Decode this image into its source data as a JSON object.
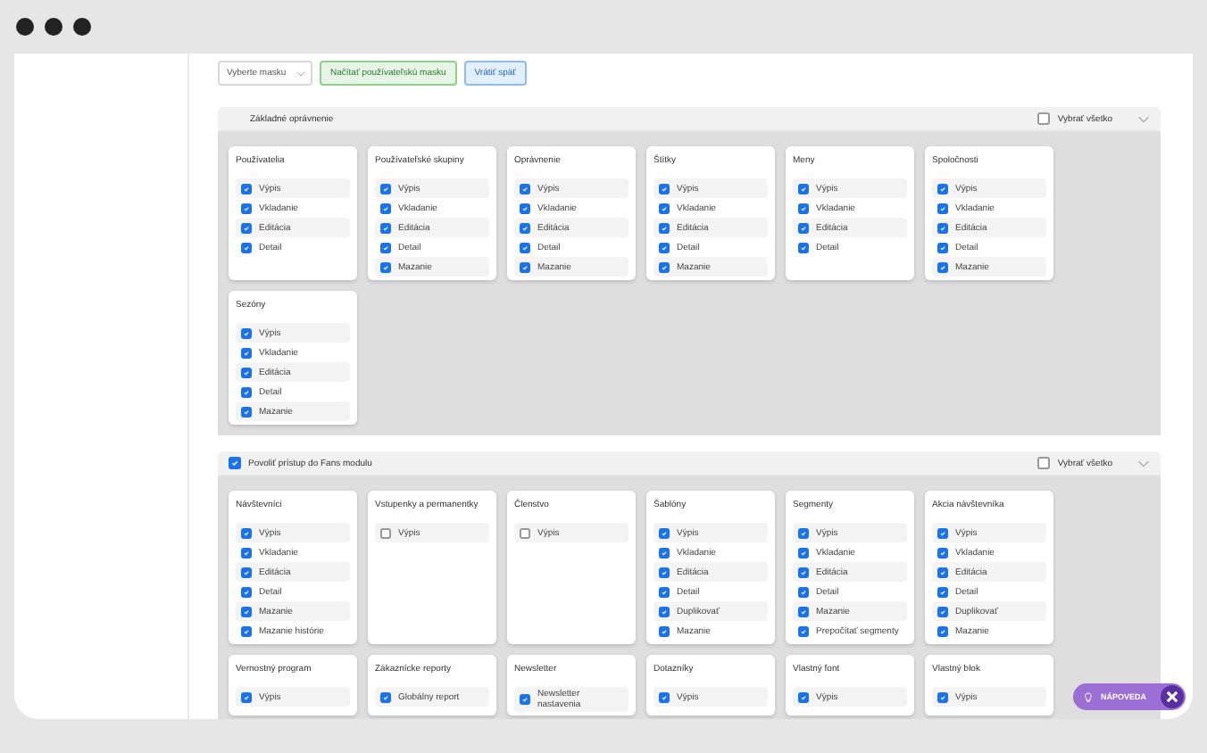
{
  "toolbar": {
    "mask_select": {
      "value": "Vyberte masku"
    },
    "buttons": [
      {
        "label": "Načítať používateľskú masku",
        "kind": "success"
      },
      {
        "label": "Vrátiť späť",
        "kind": "info"
      }
    ]
  },
  "sections": [
    {
      "kind": "heading",
      "title": "Základné oprávnenie",
      "select_all": {
        "label": "Vybrať všetko",
        "checked": false
      },
      "cards": [
        {
          "title": "Používatelia",
          "items": [
            {
              "label": "Výpis",
              "checked": true
            },
            {
              "label": "Vkladanie",
              "checked": true
            },
            {
              "label": "Editácia",
              "checked": true
            },
            {
              "label": "Detail",
              "checked": true
            }
          ]
        },
        {
          "title": "Používateľské skupiny",
          "items": [
            {
              "label": "Výpis",
              "checked": true
            },
            {
              "label": "Vkladanie",
              "checked": true
            },
            {
              "label": "Editácia",
              "checked": true
            },
            {
              "label": "Detail",
              "checked": true
            },
            {
              "label": "Mazanie",
              "checked": true
            }
          ]
        },
        {
          "title": "Oprávnenie",
          "items": [
            {
              "label": "Výpis",
              "checked": true
            },
            {
              "label": "Vkladanie",
              "checked": true
            },
            {
              "label": "Editácia",
              "checked": true
            },
            {
              "label": "Detail",
              "checked": true
            },
            {
              "label": "Mazanie",
              "checked": true
            }
          ]
        },
        {
          "title": "Štítky",
          "items": [
            {
              "label": "Výpis",
              "checked": true
            },
            {
              "label": "Vkladanie",
              "checked": true
            },
            {
              "label": "Editácia",
              "checked": true
            },
            {
              "label": "Detail",
              "checked": true
            },
            {
              "label": "Mazanie",
              "checked": true
            }
          ]
        },
        {
          "title": "Meny",
          "items": [
            {
              "label": "Výpis",
              "checked": true
            },
            {
              "label": "Vkladanie",
              "checked": true
            },
            {
              "label": "Editácia",
              "checked": true
            },
            {
              "label": "Detail",
              "checked": true
            }
          ]
        },
        {
          "title": "Spoločnosti",
          "items": [
            {
              "label": "Výpis",
              "checked": true
            },
            {
              "label": "Vkladanie",
              "checked": true
            },
            {
              "label": "Editácia",
              "checked": true
            },
            {
              "label": "Detail",
              "checked": true
            },
            {
              "label": "Mazanie",
              "checked": true
            }
          ]
        },
        {
          "title": "Sezóny",
          "items": [
            {
              "label": "Výpis",
              "checked": true
            },
            {
              "label": "Vkladanie",
              "checked": true
            },
            {
              "label": "Editácia",
              "checked": true
            },
            {
              "label": "Detail",
              "checked": true
            },
            {
              "label": "Mazanie",
              "checked": true
            }
          ]
        }
      ]
    },
    {
      "kind": "checkbox",
      "title": "Povoliť prístup do Fans modulu",
      "checked": true,
      "select_all": {
        "label": "Vybrať všetko",
        "checked": false
      },
      "cards": [
        {
          "title": "Návštevníci",
          "items": [
            {
              "label": "Výpis",
              "checked": true
            },
            {
              "label": "Vkladanie",
              "checked": true
            },
            {
              "label": "Editácia",
              "checked": true
            },
            {
              "label": "Detail",
              "checked": true
            },
            {
              "label": "Mazanie",
              "checked": true
            },
            {
              "label": "Mazanie histórie",
              "checked": true
            }
          ]
        },
        {
          "title": "Vstupenky a permanentky",
          "items": [
            {
              "label": "Výpis",
              "checked": false
            }
          ]
        },
        {
          "title": "Členstvo",
          "items": [
            {
              "label": "Výpis",
              "checked": false
            }
          ]
        },
        {
          "title": "Šablóny",
          "items": [
            {
              "label": "Výpis",
              "checked": true
            },
            {
              "label": "Vkladanie",
              "checked": true
            },
            {
              "label": "Editácia",
              "checked": true
            },
            {
              "label": "Detail",
              "checked": true
            },
            {
              "label": "Duplikovať",
              "checked": true
            },
            {
              "label": "Mazanie",
              "checked": true
            }
          ]
        },
        {
          "title": "Segmenty",
          "items": [
            {
              "label": "Výpis",
              "checked": true
            },
            {
              "label": "Vkladanie",
              "checked": true
            },
            {
              "label": "Editácia",
              "checked": true
            },
            {
              "label": "Detail",
              "checked": true
            },
            {
              "label": "Mazanie",
              "checked": true
            },
            {
              "label": "Prepočítať segmenty",
              "checked": true
            }
          ]
        },
        {
          "title": "Akcia návštevníka",
          "items": [
            {
              "label": "Výpis",
              "checked": true
            },
            {
              "label": "Vkladanie",
              "checked": true
            },
            {
              "label": "Editácia",
              "checked": true
            },
            {
              "label": "Detail",
              "checked": true
            },
            {
              "label": "Duplikovať",
              "checked": true
            },
            {
              "label": "Mazanie",
              "checked": true
            }
          ]
        },
        {
          "title": "Vernostný program",
          "items": [
            {
              "label": "Výpis",
              "checked": true
            }
          ]
        },
        {
          "title": "Zákaznícke reporty",
          "items": [
            {
              "label": "Globálny report",
              "checked": true
            }
          ]
        },
        {
          "title": "Newsletter",
          "items": [
            {
              "label": "Newsletter nastavenia",
              "checked": true
            }
          ]
        },
        {
          "title": "Dotazníky",
          "items": [
            {
              "label": "Výpis",
              "checked": true
            }
          ]
        },
        {
          "title": "Vlastný font",
          "items": [
            {
              "label": "Výpis",
              "checked": true
            }
          ]
        },
        {
          "title": "Vlastný blok",
          "items": [
            {
              "label": "Výpis",
              "checked": true
            }
          ]
        }
      ]
    }
  ],
  "help": {
    "label": "NÁPOVEDA"
  }
}
